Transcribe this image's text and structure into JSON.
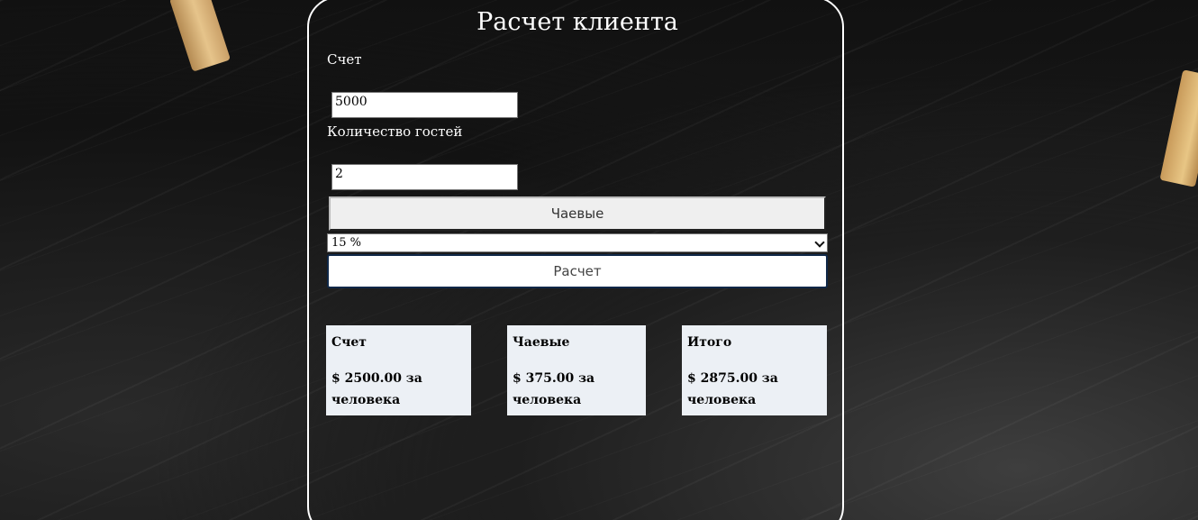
{
  "calculator": {
    "title": "Расчет клиента",
    "bill_label": "Счет",
    "bill_value": "5000",
    "guests_label": "Количество гостей",
    "guests_value": "2",
    "tip_button_label": "Чаевые",
    "tip_select": {
      "selected": "15 %"
    },
    "calculate_button_label": "Расчет"
  },
  "results": [
    {
      "title": "Счет",
      "value": "$ 2500.00 за человека"
    },
    {
      "title": "Чаевые",
      "value": "$ 375.00 за человека"
    },
    {
      "title": "Итого",
      "value": "$ 2875.00 за человека"
    }
  ],
  "colors": {
    "card_border": "#ffffff",
    "result_bg": "#ecf0f5",
    "calc_button_border": "#102848"
  }
}
